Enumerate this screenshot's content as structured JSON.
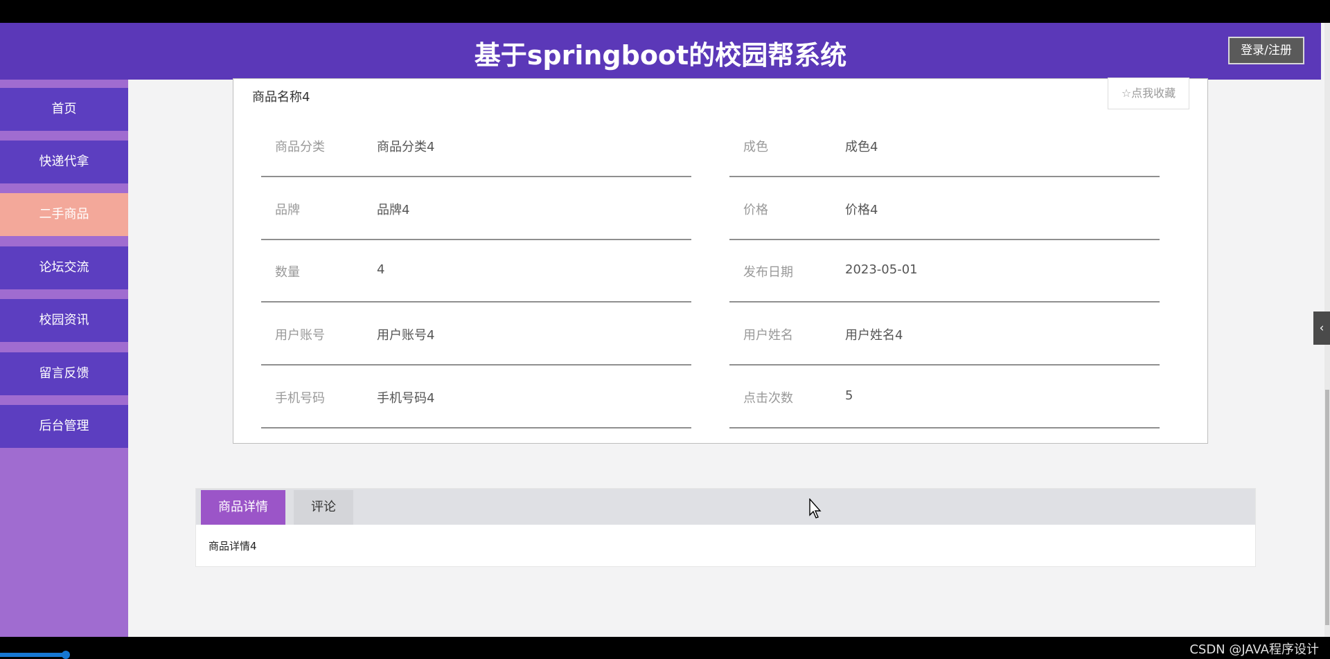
{
  "header": {
    "title": "基于springboot的校园帮系统",
    "login_label": "登录/注册"
  },
  "sidebar": {
    "items": [
      {
        "label": "首页",
        "active": false
      },
      {
        "label": "快递代拿",
        "active": false
      },
      {
        "label": "二手商品",
        "active": true
      },
      {
        "label": "论坛交流",
        "active": false
      },
      {
        "label": "校园资讯",
        "active": false
      },
      {
        "label": "留言反馈",
        "active": false
      },
      {
        "label": "后台管理",
        "active": false
      }
    ]
  },
  "product": {
    "name": "商品名称4",
    "favorite_label": "☆点我收藏",
    "fields": [
      {
        "label": "商品分类",
        "value": "商品分类4"
      },
      {
        "label": "成色",
        "value": "成色4"
      },
      {
        "label": "品牌",
        "value": "品牌4"
      },
      {
        "label": "价格",
        "value": "价格4"
      },
      {
        "label": "数量",
        "value": "4"
      },
      {
        "label": "发布日期",
        "value": "2023-05-01"
      },
      {
        "label": "用户账号",
        "value": "用户账号4"
      },
      {
        "label": "用户姓名",
        "value": "用户姓名4"
      },
      {
        "label": "手机号码",
        "value": "手机号码4"
      },
      {
        "label": "点击次数",
        "value": "5"
      }
    ]
  },
  "tabs": {
    "items": [
      {
        "label": "商品详情",
        "active": true
      },
      {
        "label": "评论",
        "active": false
      }
    ],
    "content": "商品详情4"
  },
  "footer": {
    "watermark": "CSDN @JAVA程序设计"
  },
  "icons": {
    "collapse": "chevron-left-icon",
    "cursor": "mouse-pointer-icon"
  },
  "colors": {
    "header": "#5b38b8",
    "sidebar_item": "#5c3ec0",
    "sidebar_active": "#f3a89a",
    "tab_active": "#9b55c8"
  }
}
